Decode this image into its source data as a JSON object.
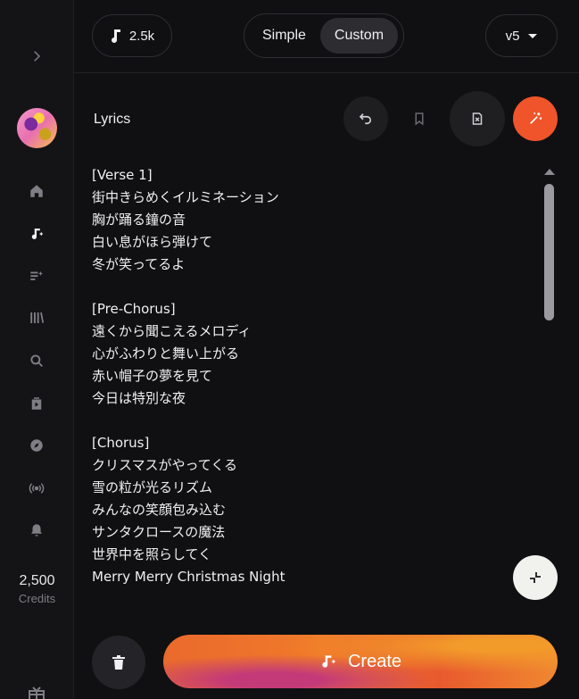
{
  "sidebar": {
    "credits_number": "2,500",
    "credits_label": "Credits",
    "nav_icons": [
      "home-icon",
      "create-music-icon",
      "playlist-add-icon",
      "library-icon",
      "search-icon",
      "video-icon",
      "explore-icon",
      "radio-icon",
      "bell-icon"
    ]
  },
  "topbar": {
    "notes_count": "2.5k",
    "mode_simple": "Simple",
    "mode_custom": "Custom",
    "version": "v5"
  },
  "lyrics": {
    "title": "Lyrics",
    "text": "[Verse 1]\n街中きらめくイルミネーション\n胸が踊る鐘の音\n白い息がほら弾けて\n冬が笑ってるよ\n\n[Pre-Chorus]\n遠くから聞こえるメロディ\n心がふわりと舞い上がる\n赤い帽子の夢を見て\n今日は特別な夜\n\n[Chorus]\nクリスマスがやってくる\n雪の粒が光るリズム\nみんなの笑顔包み込む\nサンタクロースの魔法\n世界中を照らしてく\nMerry Merry Christmas Night"
  },
  "actions": {
    "create_label": "Create"
  },
  "colors": {
    "background": "#101012",
    "accent": "#f0542a",
    "create_gradient_start": "#ea6a2c",
    "create_gradient_pink": "#c43a78"
  }
}
